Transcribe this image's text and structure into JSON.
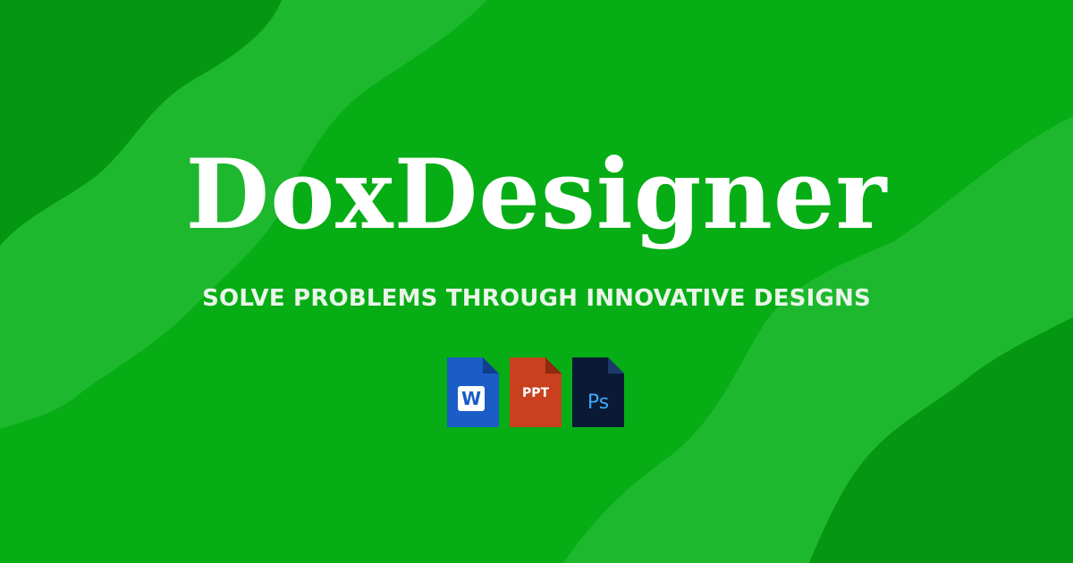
{
  "brand": {
    "title": "DoxDesigner",
    "tagline": "SOLVE PROBLEMS THROUGH INNOVATIVE DESIGNS"
  },
  "icons": [
    {
      "name": "word-file-icon",
      "label": "W"
    },
    {
      "name": "powerpoint-file-icon",
      "label": "PPT"
    },
    {
      "name": "photoshop-file-icon",
      "label": "Ps"
    }
  ],
  "colors": {
    "background": "#06ad15",
    "wave_dark": "#059612",
    "wave_light": "#1eb82e",
    "title": "#ffffff",
    "tagline": "#e9f5e9",
    "word_blue": "#1a5dc7",
    "ppt_orange": "#c8401d",
    "ps_navy": "#0a1a35",
    "ps_blue": "#41a7f5"
  }
}
